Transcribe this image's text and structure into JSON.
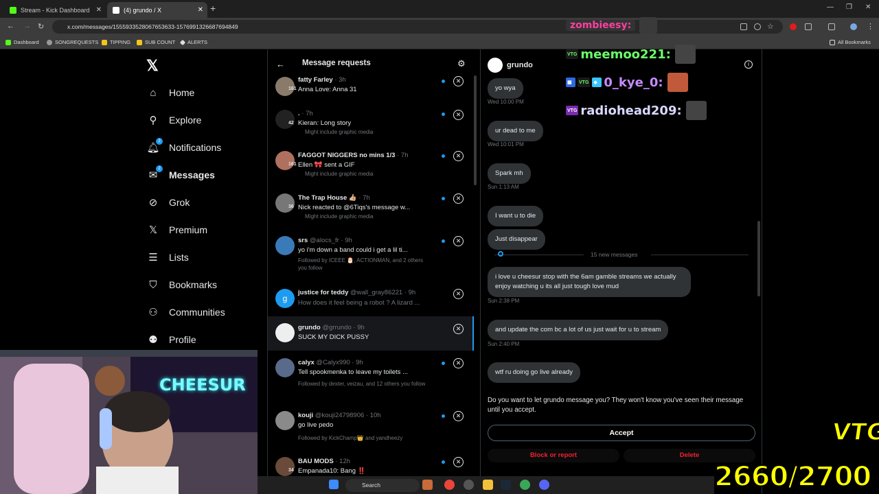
{
  "browser": {
    "tabs": [
      {
        "title": "Stream - Kick Dashboard"
      },
      {
        "title": "(4) grundo / X"
      }
    ],
    "url": "x.com/messages/1555933528067653633-1576991326687694849",
    "bookmarks": [
      "Dashboard",
      "SONGREQUESTS",
      "TIPPING",
      "SUB COUNT",
      "ALERTS"
    ],
    "all_bookmarks": "All Bookmarks"
  },
  "nav": {
    "items": [
      {
        "label": "Home",
        "icon": "home-icon"
      },
      {
        "label": "Explore",
        "icon": "search-icon"
      },
      {
        "label": "Notifications",
        "icon": "bell-icon",
        "badge": "2"
      },
      {
        "label": "Messages",
        "icon": "envelope-icon",
        "badge": "2"
      },
      {
        "label": "Grok",
        "icon": "grok-icon"
      },
      {
        "label": "Premium",
        "icon": "x-icon"
      },
      {
        "label": "Lists",
        "icon": "list-icon"
      },
      {
        "label": "Bookmarks",
        "icon": "bookmark-icon"
      },
      {
        "label": "Communities",
        "icon": "people-icon"
      },
      {
        "label": "Profile",
        "icon": "person-icon"
      }
    ]
  },
  "requests": {
    "title": "Message requests",
    "items": [
      {
        "name": "fatty Farley",
        "meta": " · 3h",
        "count": "161",
        "message": "Anna Love: Anna 31",
        "sub": "",
        "unread": true
      },
      {
        "name": ".",
        "meta": " · 7h",
        "count": "42",
        "message": "Kieran: Long story",
        "sub": "Might include graphic media",
        "unread": true
      },
      {
        "name": "FAGGOT NIGGERS no mins 1/3",
        "meta": " · 7h",
        "count": "161",
        "message": "Ellen 🎀 sent a GIF",
        "sub": "Might include graphic media",
        "unread": true
      },
      {
        "name": "The Trap House 👍🏼",
        "meta": " · 7h",
        "count": "36",
        "message": "Nick reacted to @6Tiqs's message w...",
        "sub": "Might include graphic media",
        "unread": true
      },
      {
        "name": "srs",
        "meta": " @alocs_fr · 9h",
        "count": "",
        "message": "yo i'm down a band could i get a lil ti...",
        "sub": "Followed by ICEEE 🎅, ACTIONMAN, and 2 others you follow",
        "unread": true
      },
      {
        "name": "justice for teddy",
        "meta": " @wall_gray86221 · 9h",
        "count": "",
        "message": "How does it feel being a robot ? A lizard ...",
        "sub": "",
        "unread": false
      },
      {
        "name": "grundo",
        "meta": " @grrundo · 9h",
        "count": "",
        "message": "SUCK MY DICK PUSSY",
        "sub": "",
        "unread": false
      },
      {
        "name": "calyx",
        "meta": " @Calyx990 · 9h",
        "count": "",
        "message": "Tell spookmenka to leave my toilets ...",
        "sub": "Followed by dexter, veizau, and 12 others you follow",
        "unread": true
      },
      {
        "name": "kouji",
        "meta": " @kouji24798906 · 10h",
        "count": "",
        "message": "go live pedo",
        "sub": "Followed by KickChamp👑 and yandheezy",
        "unread": true
      },
      {
        "name": "BAU MODS",
        "meta": " · 12h",
        "count": "34",
        "message": "Empanada10: Bang ‼️",
        "sub": "",
        "unread": true
      }
    ]
  },
  "chat": {
    "name": "grundo",
    "messages": [
      {
        "text": "yo wya",
        "time": "Wed 10:00 PM"
      },
      {
        "text": "ur dead to me",
        "time": "Wed 10:01 PM"
      },
      {
        "text": "Spark mh",
        "time": "Sun 1:13 AM"
      },
      {
        "text": "I want u to die",
        "time": ""
      },
      {
        "text": "Just disappear",
        "time": ""
      }
    ],
    "new_messages_label": "15 new messages",
    "new_messages": [
      {
        "text": "i love u cheesur stop with the 6am gamble streams we actually enjoy watching u its all just tough love mud",
        "time": "Sun 2:38 PM"
      },
      {
        "text": "and update the com bc a lot of us just wait for u to stream",
        "time": "Sun 2:40 PM"
      },
      {
        "text": "wtf ru doing go live already",
        "time": ""
      }
    ],
    "prompt": "Do you want to let grundo message you? They won't know you've seen their message until you accept.",
    "accept_label": "Accept",
    "block_label": "Block or report",
    "delete_label": "Delete"
  },
  "overlay": {
    "chat_users": [
      {
        "user": "zombieesy:",
        "color": "#ff3fa0",
        "badges": []
      },
      {
        "user": "meemoo221:",
        "color": "#6bff6b",
        "badges": [
          "VTG"
        ]
      },
      {
        "user": "0_kye_0:",
        "color": "#c58cff",
        "badges": [
          "VTG"
        ]
      },
      {
        "user": "radiohead209:",
        "color": "#d8d8ff",
        "badges": [
          "VTG"
        ]
      }
    ],
    "counter": "2660/2700",
    "logo": "VTG",
    "webcam_sign": "CHEESUR"
  },
  "taskbar": {
    "search": "Search"
  },
  "colors": {
    "accent": "#1d9bf0",
    "danger": "#f4212e",
    "counter": "#ffff00"
  }
}
